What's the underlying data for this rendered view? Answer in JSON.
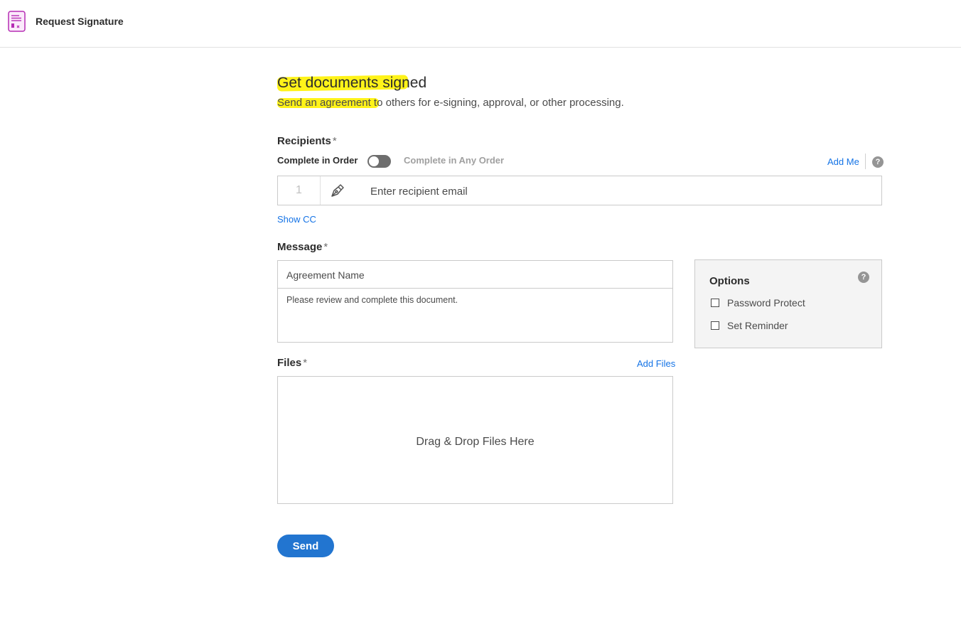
{
  "app": {
    "title": "Request Signature"
  },
  "header": {
    "title": "Get documents signed",
    "subtitle": "Send an agreement to others for e-signing, approval, or other processing."
  },
  "recipients": {
    "label": "Recipients",
    "required_mark": "*",
    "complete_in_order": "Complete in Order",
    "complete_any_order": "Complete in Any Order",
    "add_me": "Add Me",
    "help": "?",
    "rows": [
      {
        "number": "1",
        "role_icon": "pen-nib-icon",
        "placeholder": "Enter recipient email",
        "value": ""
      }
    ],
    "show_cc": "Show CC"
  },
  "message": {
    "label": "Message",
    "required_mark": "*",
    "agreement_name_placeholder": "Agreement Name",
    "body": "Please review and complete this document."
  },
  "options": {
    "title": "Options",
    "help": "?",
    "items": [
      {
        "label": "Password Protect",
        "checked": false
      },
      {
        "label": "Set Reminder",
        "checked": false
      }
    ]
  },
  "files": {
    "label": "Files",
    "required_mark": "*",
    "add_files": "Add Files",
    "drop_text": "Drag & Drop Files Here"
  },
  "actions": {
    "send": "Send"
  },
  "colors": {
    "accent": "#2275d0",
    "link": "#1473e6",
    "highlight": "#fff200",
    "app_icon": "#b62db4"
  }
}
